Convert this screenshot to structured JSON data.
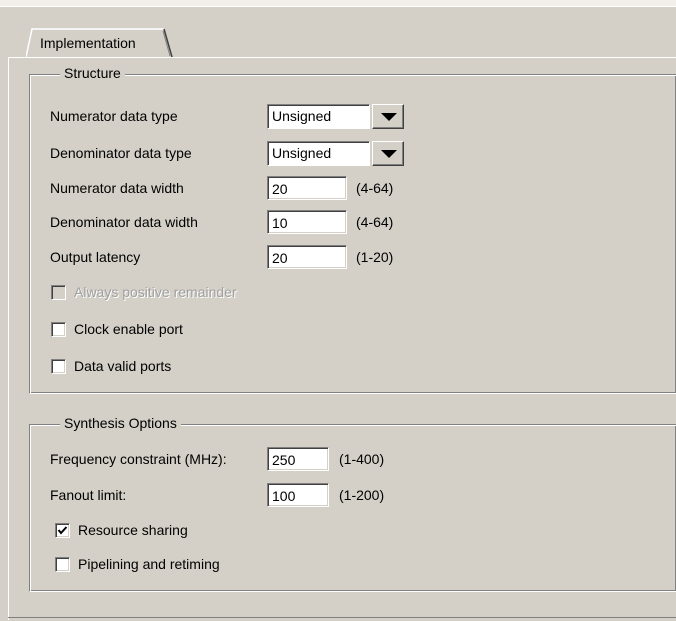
{
  "tabs": [
    {
      "label": "Implementation",
      "active": true
    }
  ],
  "structure": {
    "legend": "Structure",
    "numerator_type": {
      "label": "Numerator data type",
      "value": "Unsigned"
    },
    "denominator_type": {
      "label": "Denominator data type",
      "value": "Unsigned"
    },
    "numerator_width": {
      "label": "Numerator data width",
      "value": "20",
      "range": "(4-64)"
    },
    "denominator_width": {
      "label": "Denominator data width",
      "value": "10",
      "range": "(4-64)"
    },
    "output_latency": {
      "label": "Output latency",
      "value": "20",
      "range": "(1-20)"
    },
    "always_positive": {
      "label": "Always positive remainder",
      "checked": false,
      "enabled": false
    },
    "clock_enable": {
      "label": "Clock enable port",
      "checked": false,
      "enabled": true
    },
    "data_valid": {
      "label": "Data valid ports",
      "checked": false,
      "enabled": true
    }
  },
  "synthesis": {
    "legend": "Synthesis Options",
    "frequency": {
      "label": "Frequency constraint (MHz):",
      "value": "250",
      "range": "(1-400)"
    },
    "fanout": {
      "label": "Fanout limit:",
      "value": "100",
      "range": "(1-200)"
    },
    "resource_sharing": {
      "label": "Resource sharing",
      "checked": true,
      "enabled": true
    },
    "pipelining": {
      "label": "Pipelining and retiming",
      "checked": false,
      "enabled": true
    }
  },
  "colors": {
    "face": "#d4d0c8",
    "shadow": "#808080",
    "highlight": "#ffffff",
    "disabled_text": "#a0a0a0"
  }
}
